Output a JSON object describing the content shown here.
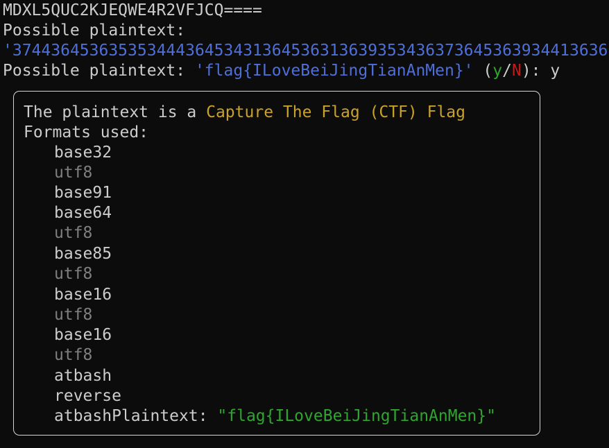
{
  "terminal": {
    "line0": "MDXL5QUC2KJEQWE4R2VFJCQ====",
    "line1": "Possible plaintext:",
    "line2_quote": "'",
    "line2_value": "37443645363535344436453431364536313639353436373645363934413636",
    "line3_prefix": "Possible plaintext: ",
    "line3_value": "'flag{ILoveBeiJingTianAnMen}'",
    "prompt_open": " (",
    "prompt_yes": "y",
    "prompt_slash": "/",
    "prompt_no": "N",
    "prompt_close": "): ",
    "prompt_answer": "y"
  },
  "panel": {
    "intro_text": "The plaintext is a ",
    "intro_highlight": "Capture The Flag (CTF) Flag",
    "formats_label": "Formats used:",
    "formats": [
      "base32",
      "utf8",
      "base91",
      "base64",
      "utf8",
      "base85",
      "utf8",
      "base16",
      "utf8",
      "base16",
      "utf8",
      "atbash",
      "reverse"
    ],
    "final_label": "atbashPlaintext: ",
    "final_value": "\"flag{ILoveBeiJingTianAnMen}\""
  },
  "colors": {
    "background": "#0c0c0c",
    "text": "#cccccc",
    "blue": "#4f6fd8",
    "green": "#2fa52f",
    "red": "#c31a1a",
    "yellow": "#c9a227",
    "grey": "#7f7f7f"
  }
}
